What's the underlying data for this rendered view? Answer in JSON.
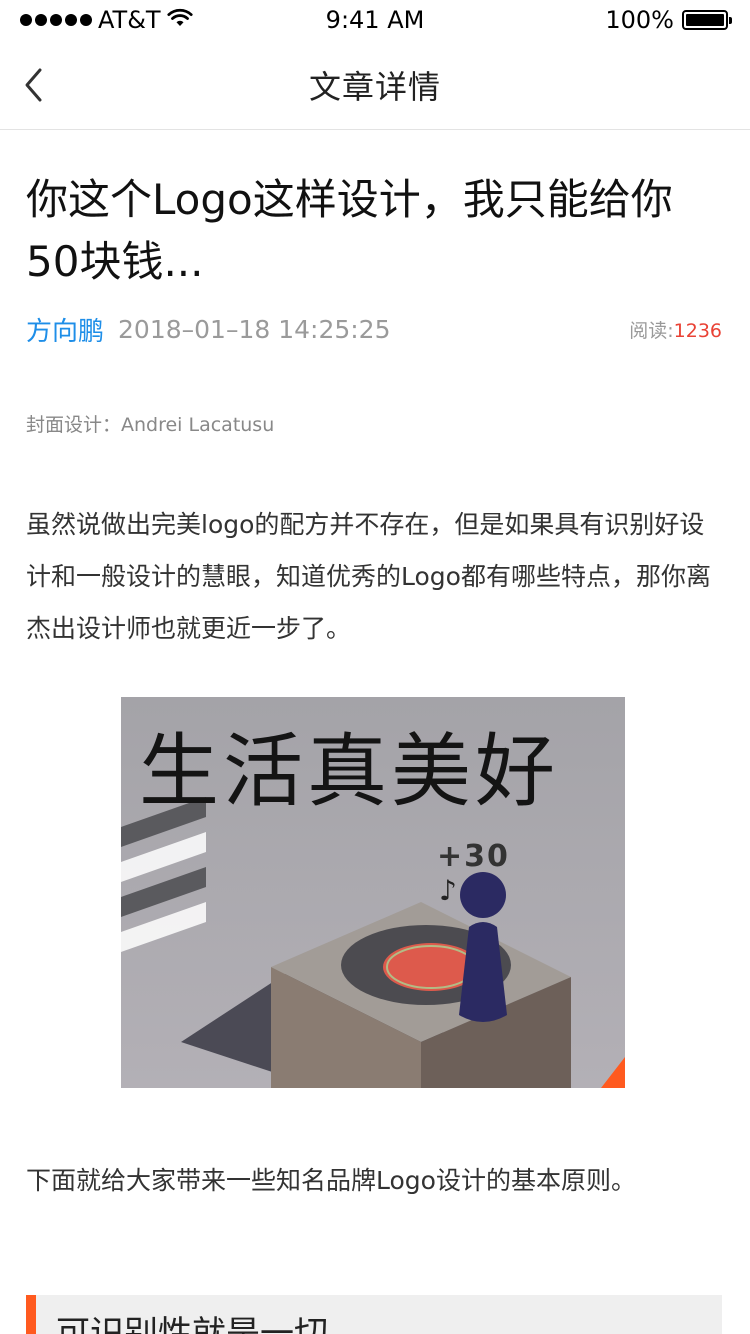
{
  "status_bar": {
    "carrier": "AT&T",
    "time": "9:41 AM",
    "battery": "100%",
    "battery_level": 1.0,
    "icons": [
      "signal-dots-icon",
      "wifi-icon",
      "battery-icon"
    ]
  },
  "nav": {
    "title": "文章详情",
    "back_icon": "chevron-left-icon"
  },
  "article": {
    "title": "你这个Logo这样设计，我只能给你50块钱...",
    "author": "方向鹏",
    "date": "2018–01–18 14:25:25",
    "reads_label": "阅读:",
    "reads_count": "1236",
    "cover_credit": "封面设计：Andrei Lacatusu",
    "paragraph1": "虽然说做出完美logo的配方并不存在，但是如果具有识别好设计和一般设计的慧眼，知道优秀的Logo都有哪些特点，那你离杰出设计师也就更近一步了。",
    "image": {
      "caption": "生活真美好",
      "score": "+30"
    },
    "paragraph2": "下面就给大家带来一些知名品牌Logo设计的基本原则。",
    "section_heading": "可识别性就是一切"
  },
  "colors": {
    "accent": "#ff5a1f",
    "author": "#1e8ee8",
    "read_count": "#e94235"
  }
}
